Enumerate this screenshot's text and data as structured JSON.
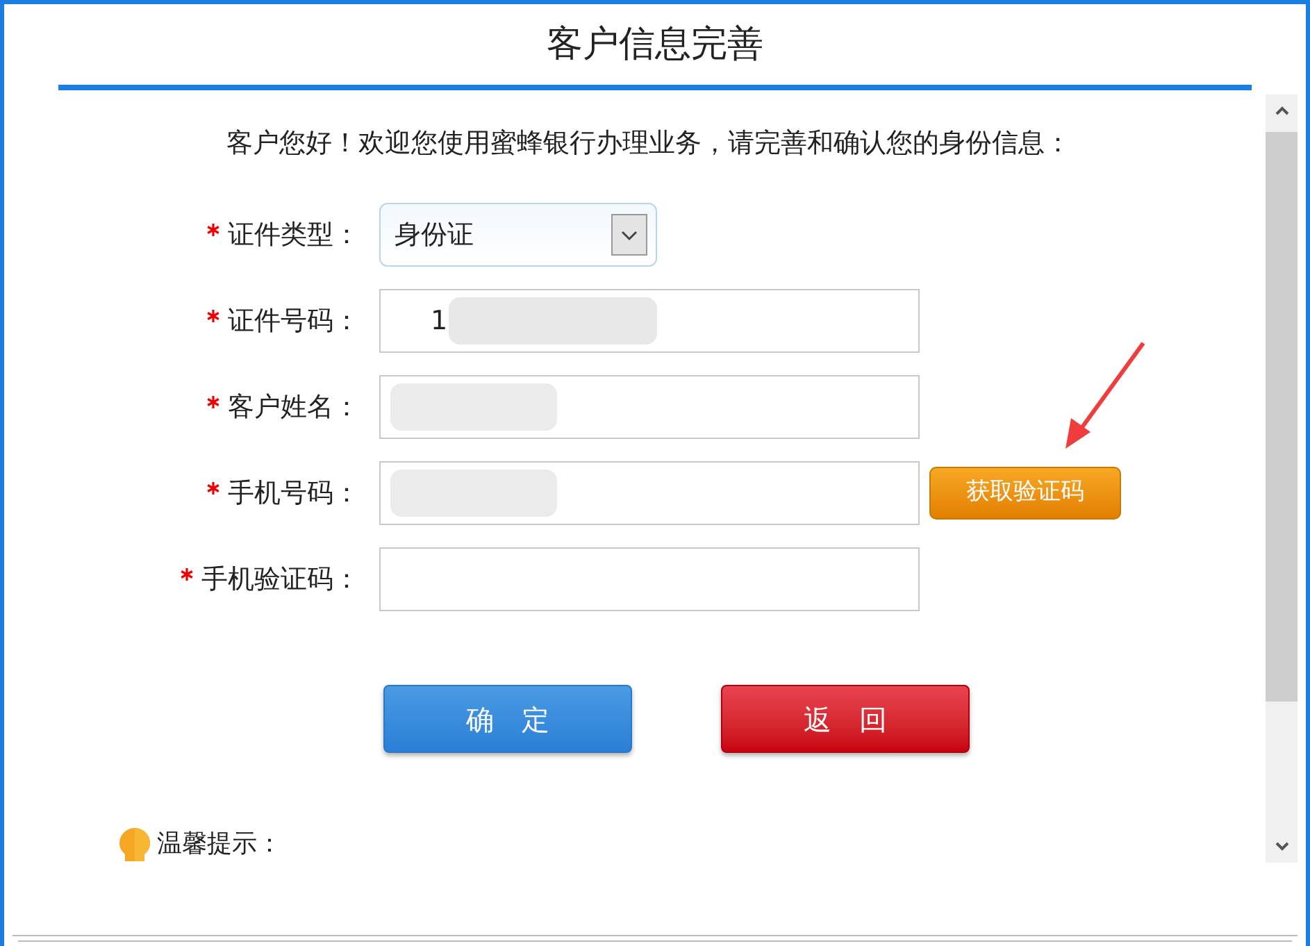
{
  "dialog": {
    "title": "客户信息完善"
  },
  "intro": "客户您好！欢迎您使用蜜蜂银行办理业务，请完善和确认您的身份信息：",
  "fields": [
    {
      "kind": "select",
      "label": "证件类型：",
      "required": true,
      "value": "身份证"
    },
    {
      "kind": "text",
      "label": "证件号码：",
      "required": true,
      "value": "1",
      "redacted": true
    },
    {
      "kind": "text",
      "label": "客户姓名：",
      "required": true,
      "redacted": true
    },
    {
      "kind": "text",
      "label": "手机号码：",
      "required": true,
      "redacted": true,
      "action": "获取验证码"
    },
    {
      "kind": "text",
      "label": "手机验证码：",
      "required": true,
      "redacted": false
    }
  ],
  "buttons": [
    {
      "label": "确　定",
      "kind": "primary"
    },
    {
      "label": "返　回",
      "kind": "danger"
    }
  ],
  "tip": {
    "title": "温馨提示："
  }
}
